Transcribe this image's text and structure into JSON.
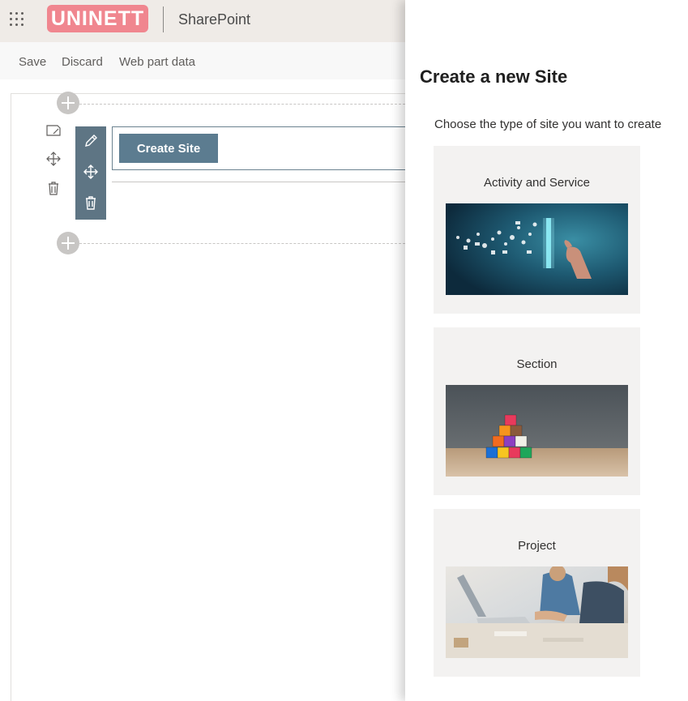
{
  "suite": {
    "logo_text": "UNINETT",
    "app_name": "SharePoint"
  },
  "commands": {
    "save": "Save",
    "discard": "Discard",
    "web_part_data": "Web part data"
  },
  "webpart": {
    "button_label": "Create Site"
  },
  "panel": {
    "title": "Create a new Site",
    "subtitle": "Choose the type of site you want to create",
    "options": [
      {
        "label": "Activity and Service",
        "image": "digital-network-hand-image"
      },
      {
        "label": "Section",
        "image": "colored-blocks-pyramid-image"
      },
      {
        "label": "Project",
        "image": "team-working-laptops-image"
      }
    ]
  },
  "colors": {
    "logo_bg": "#f0868f",
    "toolbar_bg": "#5e7584",
    "button_bg": "#5c7c90",
    "card_bg": "#f3f2f1"
  }
}
